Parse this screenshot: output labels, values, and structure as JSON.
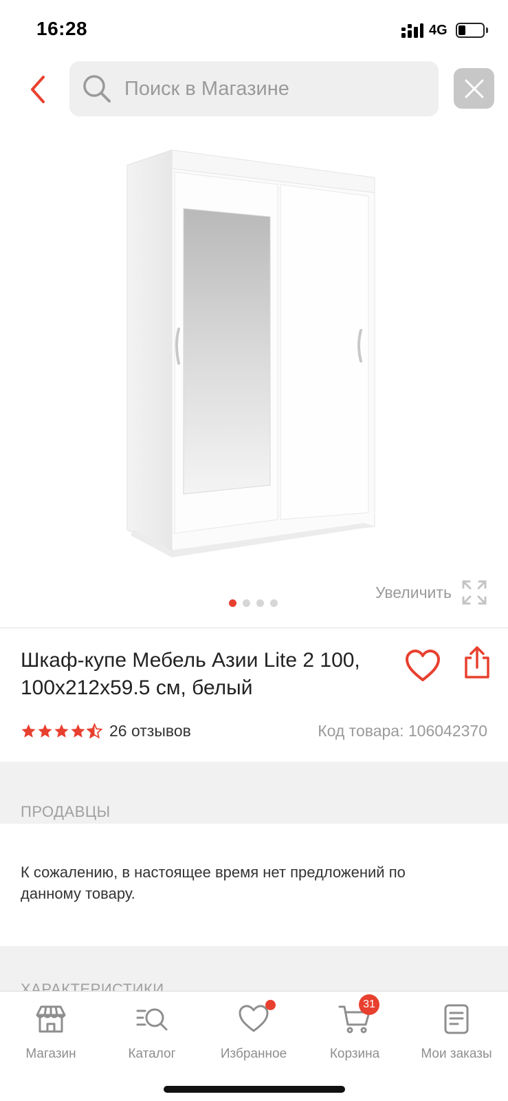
{
  "status_bar": {
    "time": "16:28",
    "network": "4G"
  },
  "search": {
    "placeholder": "Поиск в Магазине"
  },
  "gallery": {
    "zoom_label": "Увеличить",
    "image_count": 4,
    "active_index": 0
  },
  "product": {
    "title": "Шкаф-купе Мебель Азии Lite 2 100, 100x212x59.5 см, белый",
    "rating": 4.5,
    "reviews": "26 отзывов",
    "sku": "Код товара: 106042370"
  },
  "sellers": {
    "heading": "ПРОДАВЦЫ",
    "message": "К сожалению, в настоящее время нет предложений по данному товару."
  },
  "characteristics": {
    "heading": "ХАРАКТЕРИСТИКИ"
  },
  "tabbar": {
    "tabs": [
      {
        "label": "Магазин",
        "icon": "store-icon"
      },
      {
        "label": "Каталог",
        "icon": "catalog-search-icon"
      },
      {
        "label": "Избранное",
        "icon": "heart-icon"
      },
      {
        "label": "Корзина",
        "icon": "cart-icon",
        "badge": "31"
      },
      {
        "label": "Мои заказы",
        "icon": "orders-icon"
      }
    ]
  },
  "colors": {
    "accent": "#e8402f",
    "muted": "#9a9a9a",
    "section_bg": "#f1f1f1"
  }
}
